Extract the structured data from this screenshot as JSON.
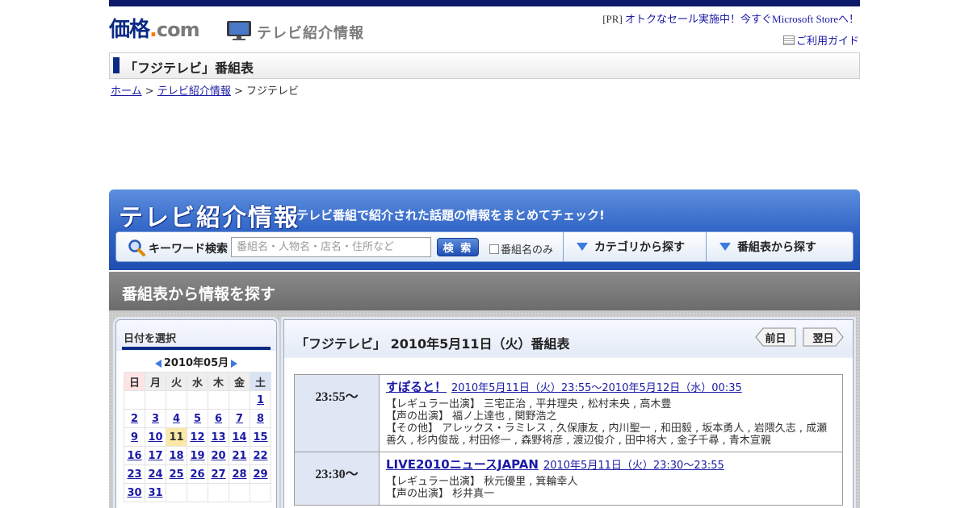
{
  "header": {
    "logo_main": "価格",
    "logo_dot": ".",
    "logo_com": "com",
    "section_title": "テレビ紹介情報",
    "pr_prefix": "[PR]",
    "pr_link": "オトクなセール実施中！今すぐMicrosoft Storeへ！",
    "guide_link": "ご利用ガイド"
  },
  "page_title": "「フジテレビ」番組表",
  "breadcrumb": {
    "home": "ホーム",
    "sep1": ">",
    "tv_info": "テレビ紹介情報",
    "sep2": ">",
    "current": "フジテレビ"
  },
  "banner": {
    "title": "テレビ紹介情報",
    "subtitle": "テレビ番組で紹介された話題の情報をまとめてチェック!",
    "keyword_label": "キーワード検索",
    "search_placeholder": "番組名・人物名・店名・住所など",
    "search_button": "検 索",
    "program_only": "番組名のみ",
    "category_link": "カテゴリから探す",
    "schedule_link": "番組表から探す"
  },
  "section_title": "番組表から情報を探す",
  "calendar": {
    "heading": "日付を選択",
    "month": "2010年05月",
    "weekdays": [
      "日",
      "月",
      "火",
      "水",
      "木",
      "金",
      "土"
    ],
    "weeks": [
      [
        "",
        "",
        "",
        "",
        "",
        "",
        "1"
      ],
      [
        "2",
        "3",
        "4",
        "5",
        "6",
        "7",
        "8"
      ],
      [
        "9",
        "10",
        "11",
        "12",
        "13",
        "14",
        "15"
      ],
      [
        "16",
        "17",
        "18",
        "19",
        "20",
        "21",
        "22"
      ],
      [
        "23",
        "24",
        "25",
        "26",
        "27",
        "28",
        "29"
      ],
      [
        "30",
        "31",
        "",
        "",
        "",
        "",
        ""
      ]
    ],
    "selected_day": "11"
  },
  "schedule": {
    "heading": "「フジテレビ」 2010年5月11日（火）番組表",
    "prev_label": "前日",
    "next_label": "翌日",
    "programs": [
      {
        "time": "23:55～",
        "title": "すぽると！",
        "airtime": "2010年5月11日（火）23:55～2010年5月12日（水）00:35",
        "cast": [
          "【レギュラー出演】 三宅正治 , 平井理央 , 松村未央 , 高木豊",
          "【声の出演】 福ノ上達也 , 関野浩之",
          "【その他】 アレックス・ラミレス , 久保康友 , 内川聖一 , 和田毅 , 坂本勇人 , 岩隈久志 , 成瀬善久 , 杉内俊哉 , 村田修一 , 森野将彦 , 渡辺俊介 , 田中将大 , 金子千尋 , 青木宣親"
        ]
      },
      {
        "time": "23:30～",
        "title": "LIVE2010ニュースJAPAN",
        "airtime": "2010年5月11日（火）23:30～23:55",
        "cast": [
          "【レギュラー出演】 秋元優里 , 箕輪幸人",
          "【声の出演】 杉井真一"
        ]
      }
    ]
  },
  "colors": {
    "brand_navy": "#0b2a85",
    "link_blue": "#1a1aa6",
    "banner_blue": "#2f62c4",
    "today_highlight": "#fde9a6"
  }
}
